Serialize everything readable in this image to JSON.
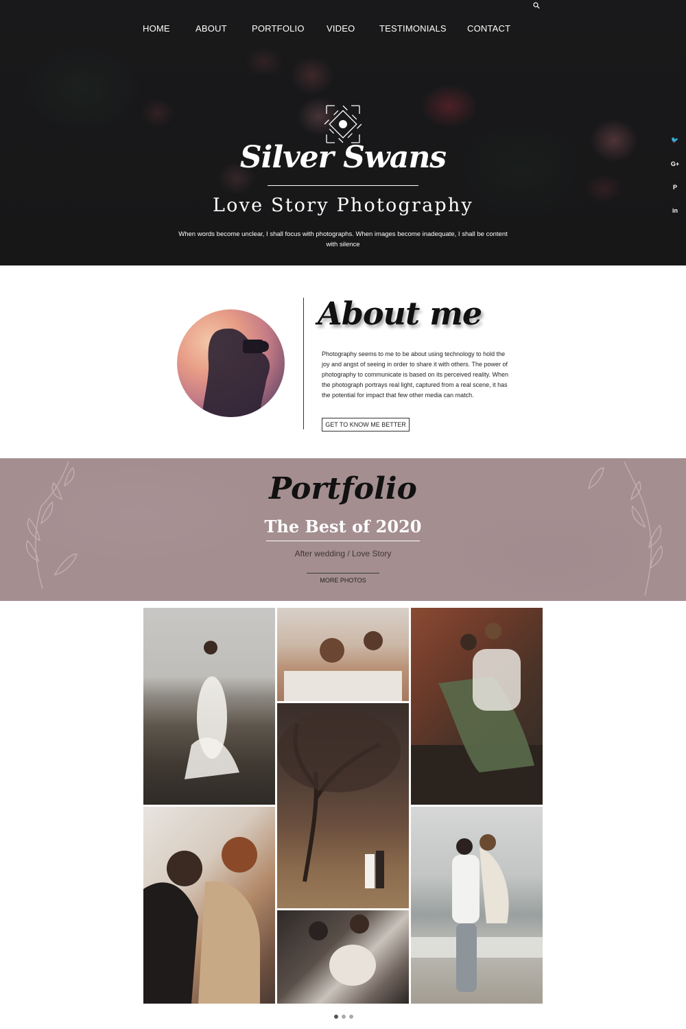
{
  "nav": {
    "items": [
      {
        "label": "HOME"
      },
      {
        "label": "ABOUT"
      },
      {
        "label": "PORTFOLIO"
      },
      {
        "label": "VIDEO"
      },
      {
        "label": "TESTIMONIALS"
      },
      {
        "label": "CONTACT"
      }
    ],
    "search_icon": "search-icon"
  },
  "hero": {
    "brand": "Silver Swans",
    "tagline": "Love Story Photography",
    "subtitle": "When words become unclear, I shall focus with photographs. When images become inadequate, I shall be content with silence"
  },
  "social": [
    {
      "icon": "twitter-icon",
      "glyph": "🐦"
    },
    {
      "icon": "google-plus-icon",
      "glyph": "G+"
    },
    {
      "icon": "pinterest-icon",
      "glyph": "P"
    },
    {
      "icon": "linkedin-icon",
      "glyph": "in"
    }
  ],
  "about": {
    "title": "About me",
    "text": "Photography seems to me to be about using technology to hold the joy and angst of seeing in order to share it with others. The power of photography to communicate is based on its perceived reality. When the photograph portrays real light, captured from a real scene, it has the potential for impact that few other media can match.",
    "button": "GET TO KNOW ME BETTER"
  },
  "portfolio": {
    "title": "Portfolio",
    "subtitle": "The Best of 2020",
    "category": "After wedding / Love Story",
    "more": "MORE PHOTOS"
  },
  "gallery": {
    "photos": [
      "couple-beach-rocks",
      "couple-bathtub",
      "couple-porch-steps",
      "couple-tree-field",
      "couple-kitchen",
      "couple-sea-embrace",
      "couple-maternity"
    ]
  },
  "carousel": {
    "dots": 3,
    "active": 0
  },
  "colors": {
    "hero_bg": "#1b1b1d",
    "band_bg": "#a48e90",
    "text_dark": "#111111",
    "white": "#ffffff",
    "dot_active": "#555555",
    "dot_inactive": "#aaaaaa"
  }
}
